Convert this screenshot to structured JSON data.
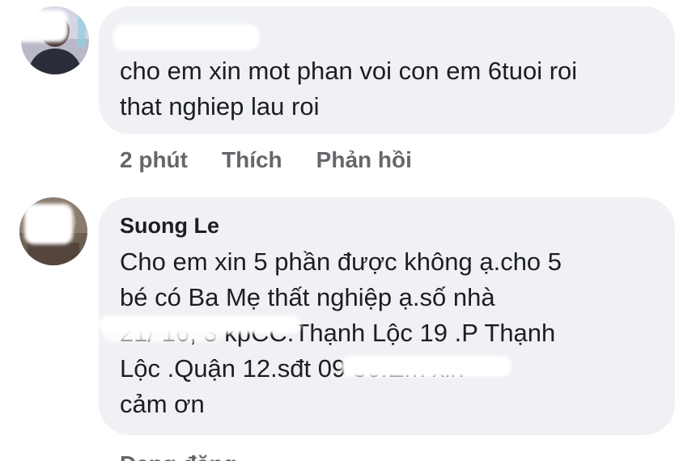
{
  "comments": [
    {
      "author": "",
      "lines": [
        "cho em xin mot phan voi con em 6tuoi roi",
        "that nghiep lau roi"
      ],
      "time": "2 phút",
      "like_label": "Thích",
      "reply_label": "Phản hồi"
    },
    {
      "author": "Suong Le",
      "lines": [
        "Cho em xin 5 phần được không ạ.cho 5",
        "bé có Ba Mẹ thất nghiệp ạ.số nhà",
        "21/ 16, 3 kpCC.Thạnh Lộc 19 .P Thạnh",
        "Lộc .Quận 12.sđt 09           36.Em xin",
        "cảm ơn"
      ]
    }
  ],
  "footer": {
    "status_text": "Đang đăng"
  },
  "colors": {
    "bubble": "#eff1f5",
    "meta_text": "#65676b",
    "body_text": "#1c1e21"
  }
}
